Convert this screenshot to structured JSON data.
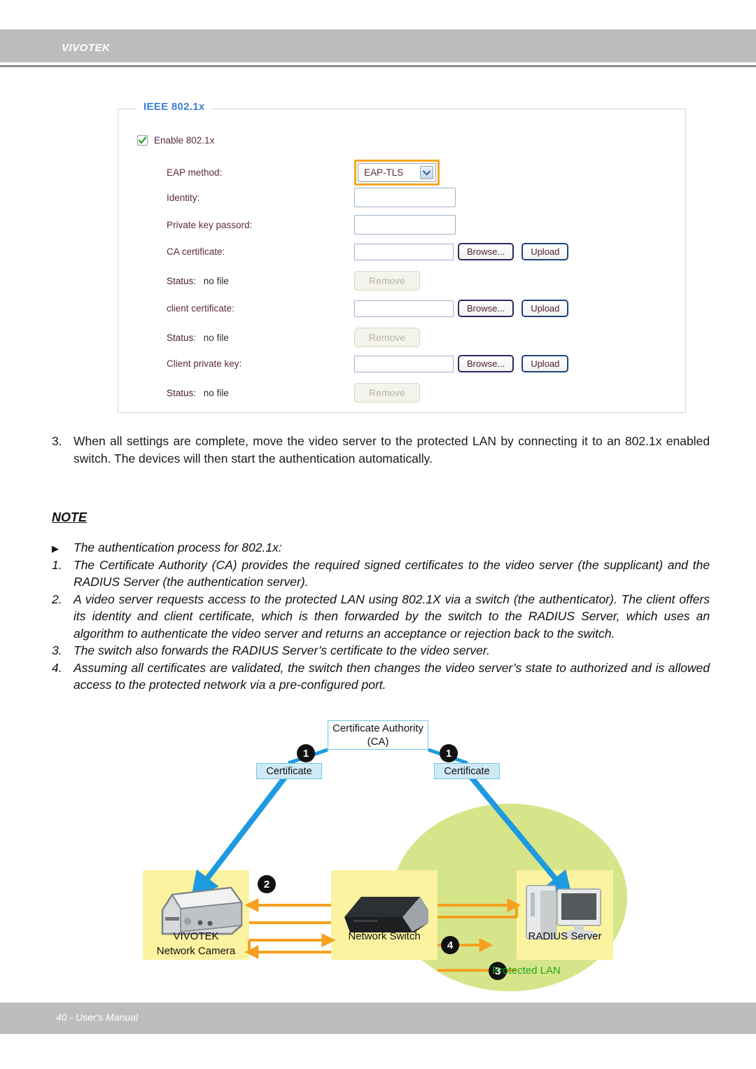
{
  "header": {
    "brand": "VIVOTEK"
  },
  "panel": {
    "legend": "IEEE 802.1x",
    "enable_checkbox": {
      "label": "Enable 802.1x",
      "checked": true
    },
    "eap": {
      "label": "EAP method:",
      "value": "EAP-TLS",
      "arrow_icon": "chevron-down-icon"
    },
    "identity": {
      "label": "Identity:",
      "value": "",
      "placeholder": ""
    },
    "private_key_password": {
      "label": "Private key passord:",
      "value": "",
      "placeholder": ""
    },
    "ca_certificate": {
      "label": "CA certificate:",
      "value": "",
      "placeholder": "",
      "browse_label": "Browse...",
      "upload_label": "Upload",
      "status_label": "Status:",
      "status_value": "no file",
      "remove_label": "Remove"
    },
    "client_certificate": {
      "label": "client certificate:",
      "value": "",
      "placeholder": "",
      "browse_label": "Browse...",
      "upload_label": "Upload",
      "status_label": "Status:",
      "status_value": "no file",
      "remove_label": "Remove"
    },
    "client_private_key": {
      "label": "Client private key:",
      "value": "",
      "placeholder": "",
      "browse_label": "Browse...",
      "upload_label": "Upload",
      "status_label": "Status:",
      "status_value": "no file",
      "remove_label": "Remove"
    },
    "colors": {
      "legend": "#3b7fd4",
      "label": "#5d2a42",
      "highlight": "#f5a623",
      "button_border": "#21447d"
    }
  },
  "body": {
    "step3_number": "3.",
    "step3_text": "When all settings are complete, move the video server to the protected LAN by connecting it to an 802.1x enabled switch. The devices will then start the authentication automatically.",
    "note_heading": "NOTE",
    "notes": [
      {
        "marker": "▶",
        "text": "The authentication process for 802.1x:"
      },
      {
        "marker": "1.",
        "text": "The Certificate Authority (CA) provides the required signed certificates to the video server (the supplicant) and the RADIUS Server (the authentication server)."
      },
      {
        "marker": "2.",
        "text": "A video server requests access to the protected LAN using 802.1X via a switch (the authenticator). The client offers its identity and client certificate, which is then forwarded by the switch to the RADIUS Server, which uses an algorithm to authenticate the video server and returns an acceptance or rejection back to the switch."
      },
      {
        "marker": "3.",
        "text": "The switch also forwards the RADIUS Server’s certificate to the video server."
      },
      {
        "marker": "4.",
        "text": "Assuming all certificates are validated, the switch then changes the video server’s state to authorized and is allowed access to the protected network via a pre-configured port."
      }
    ]
  },
  "diagram": {
    "ca_line1": "Certificate Authority",
    "ca_line2": "(CA)",
    "certificate_left": "Certificate",
    "certificate_right": "Certificate",
    "step_badge_1a": "1",
    "step_badge_1b": "1",
    "step_badge_2": "2",
    "step_badge_3": "3",
    "step_badge_4": "4",
    "camera_line1": "VIVOTEK",
    "camera_line2": "Network Camera",
    "switch_label": "Network Switch",
    "radius_label": "RADIUS Server",
    "protected_lan": "Protected LAN",
    "colors": {
      "certificate_fill": "#cfeaf5",
      "certificate_border": "#6fc7e8",
      "device_fill": "#fbf3a0",
      "lan_fill": "#d6e58a",
      "lan_text": "#1fa81f",
      "blue_arrow": "#1e9ae0",
      "orange_arrow": "#f5a01e"
    }
  },
  "footer": {
    "text": "40 - User's Manual"
  }
}
